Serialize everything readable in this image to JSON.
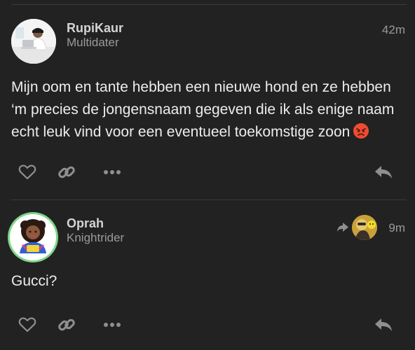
{
  "posts": [
    {
      "username": "RupiKaur",
      "user_title": "Multidater",
      "time": "42m",
      "text": "Mijn oom en tante hebben een nieuwe hond en ze hebben ‘m precies de jongensnaam gegeven die ik als enige naam echt leuk vind voor een eventueel toekomstige zoon",
      "emoji": "angry-face-emoji"
    },
    {
      "username": "Oprah",
      "user_title": "Knightrider",
      "time": "9m",
      "text": "Gucci?"
    }
  ],
  "icons": {
    "like": "heart-icon",
    "link": "link-icon",
    "more": "more-dots-icon",
    "reply": "reply-icon",
    "reply_to": "reply-arrow-icon"
  },
  "colors": {
    "background": "#222222",
    "icon": "#8f8f8f",
    "avatar_ring": "#7ed58a"
  }
}
